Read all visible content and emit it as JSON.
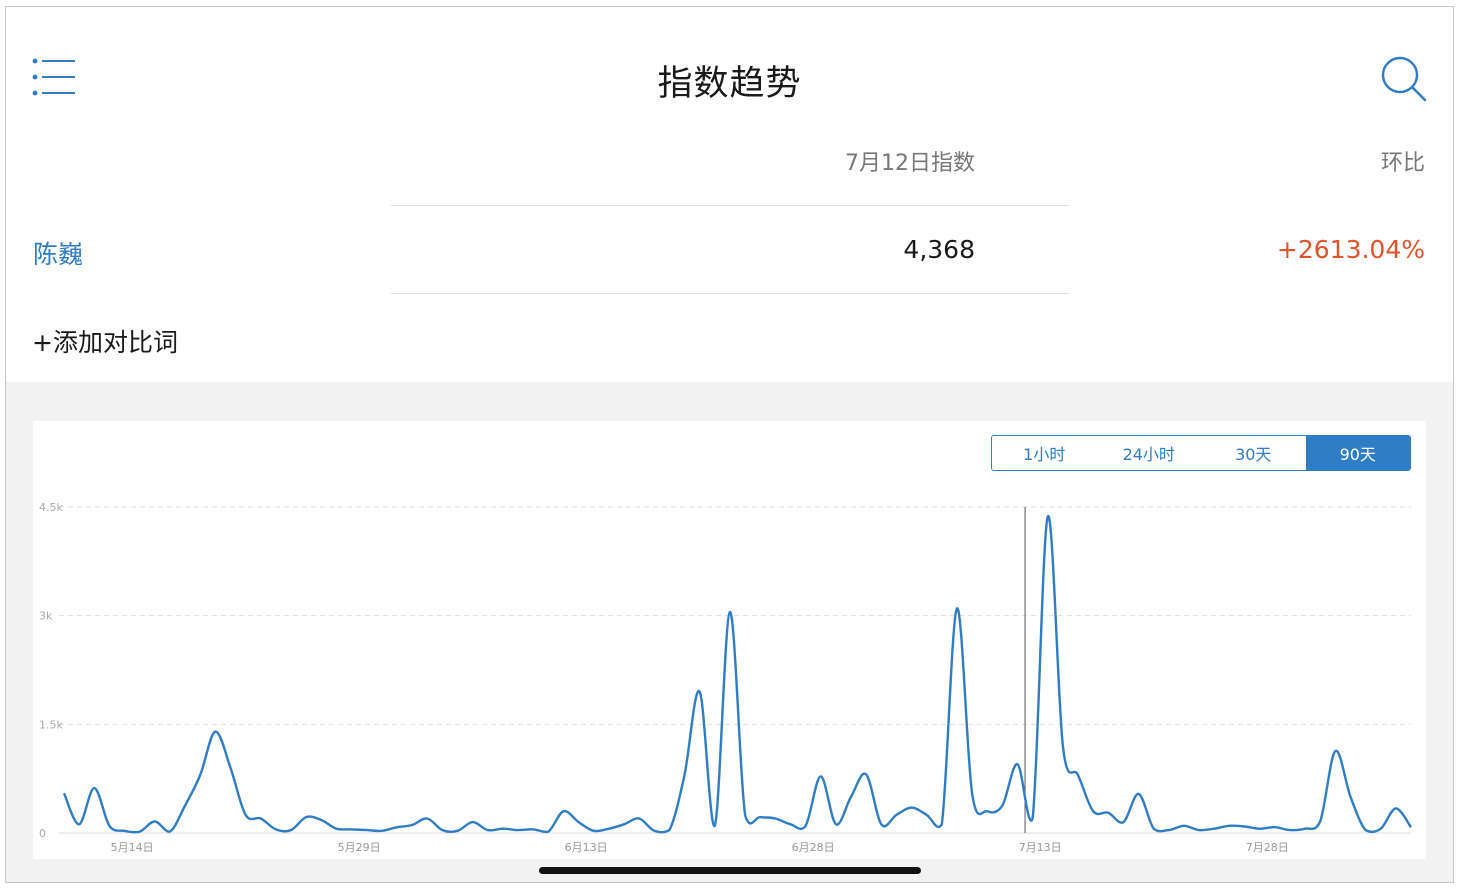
{
  "header": {
    "title": "指数趋势"
  },
  "table": {
    "col_index_label": "7月12日指数",
    "col_ratio_label": "环比",
    "rows": [
      {
        "keyword": "陈巍",
        "index": "4,368",
        "ratio": "+2613.04%"
      }
    ],
    "add_compare_label": "+添加对比词"
  },
  "range_buttons": [
    {
      "label": "1小时",
      "active": false
    },
    {
      "label": "24小时",
      "active": false
    },
    {
      "label": "30天",
      "active": false
    },
    {
      "label": "90天",
      "active": true
    }
  ],
  "colors": {
    "accent": "#2f7dc4",
    "positive_change": "#e0522a",
    "series_line": "#2f7dc4"
  },
  "icons": {
    "menu": "list-menu-icon",
    "search": "search-icon"
  },
  "chart_data": {
    "type": "line",
    "ylim": [
      0,
      4500
    ],
    "y_ticks": [
      {
        "value": 0,
        "label": "0"
      },
      {
        "value": 1500,
        "label": "1.5k"
      },
      {
        "value": 3000,
        "label": "3k"
      },
      {
        "value": 4500,
        "label": "4.5k"
      }
    ],
    "x_tick_labels": [
      {
        "day": 4.5,
        "label": "5月14日"
      },
      {
        "day": 19.5,
        "label": "5月29日"
      },
      {
        "day": 34.5,
        "label": "6月13日"
      },
      {
        "day": 49.5,
        "label": "6月28日"
      },
      {
        "day": 64.5,
        "label": "7月13日"
      },
      {
        "day": 79.5,
        "label": "7月28日"
      }
    ],
    "highlight_day": 63.5,
    "grid": "horizontal-dashed",
    "series": [
      {
        "values": [
          550,
          120,
          620,
          100,
          30,
          20,
          160,
          20,
          380,
          800,
          1400,
          900,
          250,
          200,
          50,
          40,
          220,
          180,
          60,
          50,
          40,
          30,
          80,
          110,
          200,
          40,
          30,
          150,
          40,
          60,
          40,
          50,
          20,
          300,
          150,
          30,
          60,
          120,
          200,
          30,
          40,
          800,
          1950,
          100,
          3050,
          250,
          220,
          200,
          120,
          100,
          780,
          120,
          500,
          810,
          120,
          250,
          350,
          250,
          120,
          3100,
          550,
          300,
          380,
          950,
          200,
          4368,
          1200,
          800,
          300,
          280,
          150,
          540,
          60,
          40,
          100,
          40,
          60,
          100,
          90,
          60,
          80,
          40,
          60,
          160,
          1130,
          500,
          40,
          60,
          340,
          80
        ]
      }
    ]
  }
}
